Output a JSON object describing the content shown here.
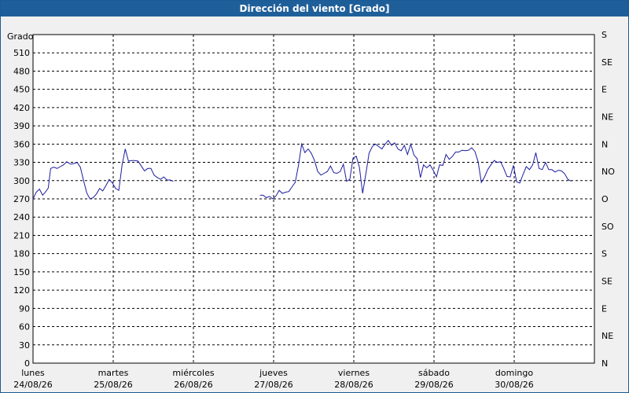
{
  "window": {
    "title": "Dirección del viento [Grado]"
  },
  "chart_data": {
    "type": "line",
    "title": "Dirección del viento [Grado]",
    "ylabel": "Grado",
    "ylim": [
      0,
      540
    ],
    "yticks": [
      0,
      30,
      60,
      90,
      120,
      150,
      180,
      210,
      240,
      270,
      300,
      330,
      360,
      390,
      420,
      450,
      480,
      510
    ],
    "right_axis_labels": [
      "N",
      "NE",
      "E",
      "SE",
      "S",
      "SO",
      "O",
      "NO",
      "N",
      "NE",
      "E",
      "SE",
      "S"
    ],
    "right_axis_values": [
      0,
      45,
      90,
      135,
      180,
      225,
      270,
      315,
      360,
      405,
      450,
      495,
      540
    ],
    "xlim": [
      0,
      7
    ],
    "x_labels": [
      {
        "day": "lunes",
        "date": "24/08/26"
      },
      {
        "day": "martes",
        "date": "25/08/26"
      },
      {
        "day": "miércoles",
        "date": "26/08/26"
      },
      {
        "day": "jueves",
        "date": "27/08/26"
      },
      {
        "day": "viernes",
        "date": "28/08/26"
      },
      {
        "day": "sábado",
        "date": "29/08/26"
      },
      {
        "day": "domingo",
        "date": "30/08/26"
      }
    ],
    "grid": true,
    "line_color": "#1c1ca0",
    "series": [
      {
        "points": [
          [
            0.0,
            270
          ],
          [
            0.04,
            281
          ],
          [
            0.08,
            286
          ],
          [
            0.12,
            276
          ],
          [
            0.16,
            282
          ],
          [
            0.19,
            288
          ],
          [
            0.22,
            320
          ],
          [
            0.26,
            322
          ],
          [
            0.3,
            320
          ],
          [
            0.34,
            323
          ],
          [
            0.38,
            326
          ],
          [
            0.42,
            331
          ],
          [
            0.47,
            327
          ],
          [
            0.51,
            328
          ],
          [
            0.55,
            330
          ],
          [
            0.59,
            322
          ],
          [
            0.63,
            300
          ],
          [
            0.67,
            280
          ],
          [
            0.71,
            270
          ],
          [
            0.75,
            272
          ],
          [
            0.79,
            278
          ],
          [
            0.83,
            287
          ],
          [
            0.87,
            283
          ],
          [
            0.91,
            292
          ],
          [
            0.95,
            302
          ],
          [
            0.99,
            296
          ],
          [
            1.03,
            287
          ],
          [
            1.07,
            284
          ],
          [
            1.11,
            325
          ],
          [
            1.15,
            352
          ],
          [
            1.19,
            332
          ],
          [
            1.23,
            333
          ],
          [
            1.27,
            333
          ],
          [
            1.31,
            332
          ],
          [
            1.35,
            324
          ],
          [
            1.39,
            316
          ],
          [
            1.43,
            320
          ],
          [
            1.47,
            320
          ],
          [
            1.51,
            309
          ],
          [
            1.55,
            305
          ],
          [
            1.59,
            302
          ],
          [
            1.63,
            306
          ],
          [
            1.67,
            301
          ],
          [
            1.71,
            301
          ],
          [
            1.75,
            299
          ]
        ]
      },
      {
        "points": [
          [
            2.83,
            276
          ],
          [
            2.87,
            276
          ],
          [
            2.91,
            272
          ],
          [
            2.95,
            274
          ],
          [
            2.99,
            270
          ],
          [
            3.03,
            275
          ],
          [
            3.07,
            284
          ],
          [
            3.11,
            279
          ],
          [
            3.15,
            281
          ],
          [
            3.19,
            282
          ],
          [
            3.23,
            290
          ],
          [
            3.27,
            297
          ],
          [
            3.31,
            325
          ],
          [
            3.35,
            360
          ],
          [
            3.39,
            346
          ],
          [
            3.43,
            352
          ],
          [
            3.47,
            345
          ],
          [
            3.51,
            333
          ],
          [
            3.55,
            315
          ],
          [
            3.59,
            309
          ],
          [
            3.63,
            312
          ],
          [
            3.67,
            315
          ],
          [
            3.71,
            324
          ],
          [
            3.75,
            313
          ],
          [
            3.79,
            312
          ],
          [
            3.83,
            315
          ],
          [
            3.87,
            327
          ],
          [
            3.91,
            299
          ],
          [
            3.95,
            302
          ],
          [
            3.99,
            337
          ],
          [
            4.03,
            340
          ],
          [
            4.07,
            322
          ],
          [
            4.11,
            279
          ],
          [
            4.15,
            311
          ],
          [
            4.19,
            345
          ],
          [
            4.23,
            356
          ],
          [
            4.27,
            360
          ],
          [
            4.31,
            356
          ],
          [
            4.35,
            352
          ],
          [
            4.39,
            360
          ],
          [
            4.43,
            366
          ],
          [
            4.47,
            358
          ],
          [
            4.51,
            362
          ],
          [
            4.55,
            352
          ],
          [
            4.59,
            349
          ],
          [
            4.63,
            358
          ],
          [
            4.67,
            343
          ],
          [
            4.71,
            360
          ],
          [
            4.75,
            342
          ],
          [
            4.79,
            336
          ],
          [
            4.83,
            305
          ],
          [
            4.87,
            326
          ],
          [
            4.91,
            321
          ],
          [
            4.95,
            326
          ],
          [
            4.99,
            317
          ],
          [
            5.03,
            306
          ],
          [
            5.07,
            326
          ],
          [
            5.11,
            325
          ],
          [
            5.15,
            343
          ],
          [
            5.19,
            335
          ],
          [
            5.23,
            340
          ],
          [
            5.27,
            347
          ],
          [
            5.31,
            347
          ],
          [
            5.35,
            350
          ],
          [
            5.39,
            349
          ],
          [
            5.43,
            350
          ],
          [
            5.47,
            354
          ],
          [
            5.51,
            348
          ],
          [
            5.55,
            331
          ],
          [
            5.59,
            297
          ],
          [
            5.63,
            306
          ],
          [
            5.67,
            318
          ],
          [
            5.71,
            326
          ],
          [
            5.75,
            333
          ],
          [
            5.79,
            330
          ],
          [
            5.83,
            331
          ],
          [
            5.87,
            320
          ],
          [
            5.91,
            307
          ],
          [
            5.95,
            306
          ],
          [
            5.99,
            325
          ],
          [
            6.03,
            298
          ],
          [
            6.07,
            296
          ],
          [
            6.11,
            310
          ],
          [
            6.15,
            323
          ],
          [
            6.19,
            318
          ],
          [
            6.23,
            326
          ],
          [
            6.27,
            346
          ],
          [
            6.31,
            320
          ],
          [
            6.35,
            318
          ],
          [
            6.39,
            330
          ],
          [
            6.43,
            318
          ],
          [
            6.47,
            318
          ],
          [
            6.51,
            314
          ],
          [
            6.55,
            317
          ],
          [
            6.59,
            316
          ],
          [
            6.63,
            311
          ],
          [
            6.67,
            302
          ],
          [
            6.71,
            299
          ]
        ]
      }
    ]
  }
}
